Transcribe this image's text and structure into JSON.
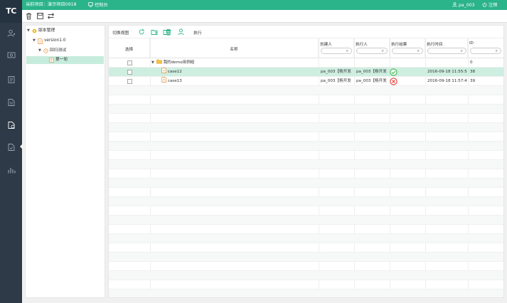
{
  "app": {
    "logo": "TC"
  },
  "topbar": {
    "project_label": "当前项目：演示项目0918",
    "console_label": "控制台",
    "user": "pa_003",
    "logout": "注销"
  },
  "toolbar": {
    "icons": [
      "trash-icon",
      "save-icon",
      "switch-icon"
    ]
  },
  "sidebar": {
    "items": [
      "user-icon",
      "device-icon",
      "report-icon",
      "doc-icon",
      "case-icon",
      "task-icon",
      "stats-icon"
    ]
  },
  "tree": {
    "root": "版本管理",
    "version": "version1.0",
    "test": "回归测试",
    "round": "第一轮"
  },
  "grid": {
    "toolbar": {
      "switch_view": "切换视图",
      "execute": "执行"
    },
    "columns": {
      "select": "选择",
      "name": "名称",
      "creator": "创建人",
      "executor": "执行人",
      "result": "执行结果",
      "exec_time": "执行时间",
      "id": "ID"
    },
    "rows": [
      {
        "name": "我的demo用例组",
        "creator": "",
        "executor": "",
        "result": "",
        "exec_time": "",
        "id": "0"
      },
      {
        "name": "case12",
        "creator": "pa_003【杨开发",
        "executor": "pa_003【杨开发",
        "result": "pass",
        "exec_time": "2016-09-18 11:55:5",
        "id": "38"
      },
      {
        "name": "case13",
        "creator": "pa_003【杨开发",
        "executor": "pa_003【杨开发",
        "result": "fail",
        "exec_time": "2016-09-18 11:57:4",
        "id": "39"
      }
    ]
  },
  "colors": {
    "accent": "#2bb389",
    "sidebar": "#2e3a47",
    "pass": "#3cb44b",
    "fail": "#e53935"
  }
}
